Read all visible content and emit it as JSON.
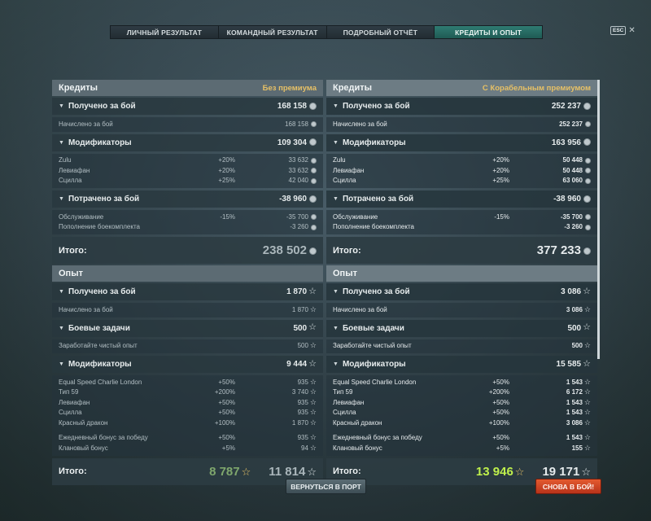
{
  "tabs": [
    "ЛИЧНЫЙ РЕЗУЛЬТАТ",
    "КОМАНДНЫЙ РЕЗУЛЬТАТ",
    "ПОДРОБНЫЙ ОТЧЁТ",
    "КРЕДИТЫ И ОПЫТ"
  ],
  "active_tab": 3,
  "esc_label": "ESC",
  "buttons": {
    "port": "ВЕРНУТЬСЯ В ПОРТ",
    "battle": "СНОВА В БОЙ!"
  },
  "left": {
    "credits": {
      "title": "Кредиты",
      "premium": "Без премиума",
      "received": {
        "label": "Получено за бой",
        "value": "168 158",
        "rows": [
          {
            "name": "Начислено за бой",
            "pct": "",
            "value": "168 158"
          }
        ]
      },
      "modifiers": {
        "label": "Модификаторы",
        "value": "109 304",
        "rows": [
          {
            "name": "Zulu",
            "pct": "+20%",
            "value": "33 632"
          },
          {
            "name": "Левиафан",
            "pct": "+20%",
            "value": "33 632"
          },
          {
            "name": "Сцилла",
            "pct": "+25%",
            "value": "42 040"
          }
        ]
      },
      "spent": {
        "label": "Потрачено за бой",
        "value": "-38 960",
        "rows": [
          {
            "name": "Обслуживание",
            "pct": "-15%",
            "value": "-35 700"
          },
          {
            "name": "Пополнение боекомплекта",
            "pct": "",
            "value": "-3 260"
          }
        ]
      },
      "total": {
        "label": "Итого:",
        "value": "238 502"
      }
    },
    "xp": {
      "title": "Опыт",
      "received": {
        "label": "Получено за бой",
        "value": "1 870",
        "rows": [
          {
            "name": "Начислено за бой",
            "pct": "",
            "value": "1 870"
          }
        ]
      },
      "tasks": {
        "label": "Боевые задачи",
        "value": "500",
        "rows": [
          {
            "name": "Заработайте чистый опыт",
            "pct": "",
            "value": "500"
          }
        ]
      },
      "modifiers": {
        "label": "Модификаторы",
        "value": "9 444",
        "rows": [
          {
            "name": "Equal Speed Charlie London",
            "pct": "+50%",
            "value": "935"
          },
          {
            "name": "Тип 59",
            "pct": "+200%",
            "value": "3 740"
          },
          {
            "name": "Левиафан",
            "pct": "+50%",
            "value": "935"
          },
          {
            "name": "Сцилла",
            "pct": "+50%",
            "value": "935"
          },
          {
            "name": "Красный дракон",
            "pct": "+100%",
            "value": "1 870"
          }
        ],
        "rows2": [
          {
            "name": "Ежедневный бонус за победу",
            "pct": "+50%",
            "value": "935"
          },
          {
            "name": "Клановый бонус",
            "pct": "+5%",
            "value": "94"
          }
        ]
      },
      "total": {
        "label": "Итого:",
        "free": "8 787",
        "value": "11 814"
      }
    }
  },
  "right": {
    "credits": {
      "title": "Кредиты",
      "premium": "С Корабельным премиумом",
      "received": {
        "label": "Получено за бой",
        "value": "252 237",
        "rows": [
          {
            "name": "Начислено за бой",
            "pct": "",
            "value": "252 237"
          }
        ]
      },
      "modifiers": {
        "label": "Модификаторы",
        "value": "163 956",
        "rows": [
          {
            "name": "Zulu",
            "pct": "+20%",
            "value": "50 448"
          },
          {
            "name": "Левиафан",
            "pct": "+20%",
            "value": "50 448"
          },
          {
            "name": "Сцилла",
            "pct": "+25%",
            "value": "63 060"
          }
        ]
      },
      "spent": {
        "label": "Потрачено за бой",
        "value": "-38 960",
        "rows": [
          {
            "name": "Обслуживание",
            "pct": "-15%",
            "value": "-35 700"
          },
          {
            "name": "Пополнение боекомплекта",
            "pct": "",
            "value": "-3 260"
          }
        ]
      },
      "total": {
        "label": "Итого:",
        "value": "377 233"
      }
    },
    "xp": {
      "title": "Опыт",
      "received": {
        "label": "Получено за бой",
        "value": "3 086",
        "rows": [
          {
            "name": "Начислено за бой",
            "pct": "",
            "value": "3 086"
          }
        ]
      },
      "tasks": {
        "label": "Боевые задачи",
        "value": "500",
        "rows": [
          {
            "name": "Заработайте чистый опыт",
            "pct": "",
            "value": "500"
          }
        ]
      },
      "modifiers": {
        "label": "Модификаторы",
        "value": "15 585",
        "rows": [
          {
            "name": "Equal Speed Charlie London",
            "pct": "+50%",
            "value": "1 543"
          },
          {
            "name": "Тип 59",
            "pct": "+200%",
            "value": "6 172"
          },
          {
            "name": "Левиафан",
            "pct": "+50%",
            "value": "1 543"
          },
          {
            "name": "Сцилла",
            "pct": "+50%",
            "value": "1 543"
          },
          {
            "name": "Красный дракон",
            "pct": "+100%",
            "value": "3 086"
          }
        ],
        "rows2": [
          {
            "name": "Ежедневный бонус за победу",
            "pct": "+50%",
            "value": "1 543"
          },
          {
            "name": "Клановый бонус",
            "pct": "+5%",
            "value": "155"
          }
        ]
      },
      "total": {
        "label": "Итого:",
        "free": "13 946",
        "value": "19 171"
      }
    }
  }
}
